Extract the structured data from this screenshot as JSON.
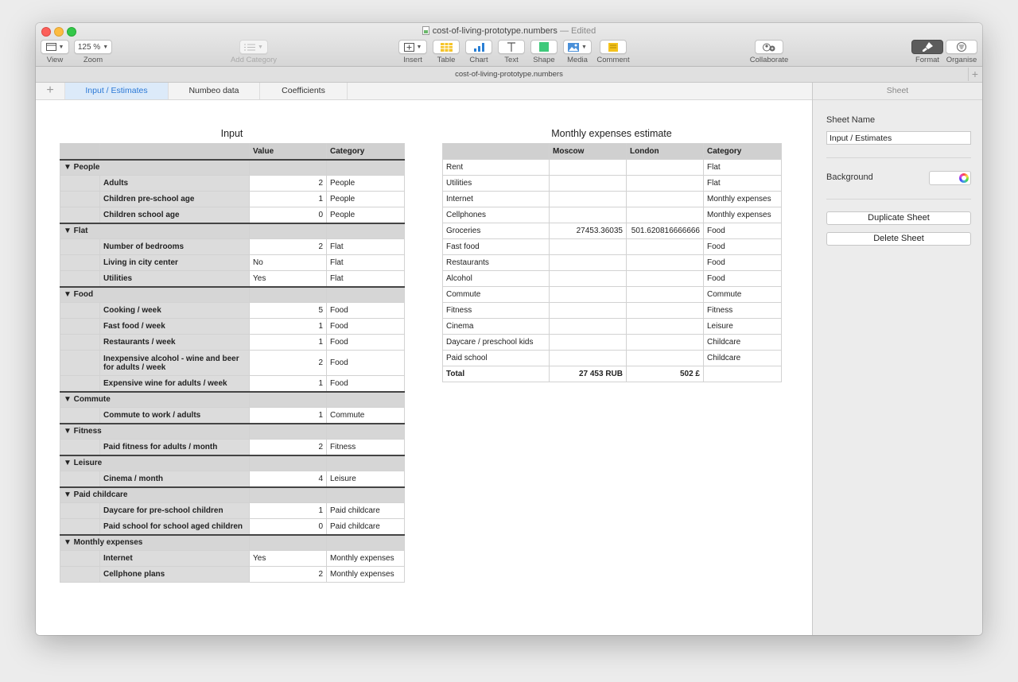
{
  "window": {
    "filename": "cost-of-living-prototype.numbers",
    "edited_suffix": "— Edited",
    "filename_bar": "cost-of-living-prototype.numbers"
  },
  "toolbar": {
    "view_label": "View",
    "zoom_value": "125 %",
    "zoom_label": "Zoom",
    "add_category_label": "Add Category",
    "insert_label": "Insert",
    "table_label": "Table",
    "chart_label": "Chart",
    "text_label": "Text",
    "shape_label": "Shape",
    "media_label": "Media",
    "comment_label": "Comment",
    "collaborate_label": "Collaborate",
    "format_label": "Format",
    "organise_label": "Organise"
  },
  "tabs": [
    {
      "label": "Input / Estimates",
      "active": true
    },
    {
      "label": "Numbeo data",
      "active": false
    },
    {
      "label": "Coefficients",
      "active": false
    }
  ],
  "input_table": {
    "title": "Input",
    "headers": [
      "",
      "",
      "Value",
      "Category"
    ],
    "rows": [
      {
        "type": "group",
        "label": "▼ People"
      },
      {
        "type": "item",
        "label": "Adults",
        "value": "2",
        "num": true,
        "category": "People"
      },
      {
        "type": "item",
        "label": "Children pre-school age",
        "value": "1",
        "num": true,
        "category": "People"
      },
      {
        "type": "item",
        "label": "Children school age",
        "value": "0",
        "num": true,
        "category": "People"
      },
      {
        "type": "group",
        "label": "▼ Flat"
      },
      {
        "type": "item",
        "label": "Number of bedrooms",
        "value": "2",
        "num": true,
        "category": "Flat"
      },
      {
        "type": "item",
        "label": "Living in city center",
        "value": "No",
        "num": false,
        "category": "Flat"
      },
      {
        "type": "item",
        "label": "Utilities",
        "value": "Yes",
        "num": false,
        "category": "Flat"
      },
      {
        "type": "group",
        "label": "▼ Food"
      },
      {
        "type": "item",
        "label": "Cooking / week",
        "value": "5",
        "num": true,
        "category": "Food"
      },
      {
        "type": "item",
        "label": "Fast food / week",
        "value": "1",
        "num": true,
        "category": "Food"
      },
      {
        "type": "item",
        "label": "Restaurants / week",
        "value": "1",
        "num": true,
        "category": "Food"
      },
      {
        "type": "item",
        "label": "Inexpensive alcohol - wine and beer for adults / week",
        "value": "2",
        "num": true,
        "category": "Food",
        "tall": true
      },
      {
        "type": "item",
        "label": "Expensive wine for adults / week",
        "value": "1",
        "num": true,
        "category": "Food"
      },
      {
        "type": "group",
        "label": "▼ Commute"
      },
      {
        "type": "item",
        "label": "Commute to work / adults",
        "value": "1",
        "num": true,
        "category": "Commute"
      },
      {
        "type": "group",
        "label": "▼ Fitness"
      },
      {
        "type": "item",
        "label": "Paid fitness for adults / month",
        "value": "2",
        "num": true,
        "category": "Fitness"
      },
      {
        "type": "group",
        "label": "▼ Leisure"
      },
      {
        "type": "item",
        "label": "Cinema / month",
        "value": "4",
        "num": true,
        "category": "Leisure"
      },
      {
        "type": "group",
        "label": "▼ Paid childcare"
      },
      {
        "type": "item",
        "label": "Daycare for pre-school children",
        "value": "1",
        "num": true,
        "category": "Paid childcare"
      },
      {
        "type": "item",
        "label": "Paid school for school aged children",
        "value": "0",
        "num": true,
        "category": "Paid childcare"
      },
      {
        "type": "group",
        "label": "▼ Monthly expenses"
      },
      {
        "type": "item",
        "label": "Internet",
        "value": "Yes",
        "num": false,
        "category": "Monthly expenses"
      },
      {
        "type": "item",
        "label": "Cellphone plans",
        "value": "2",
        "num": true,
        "category": "Monthly expenses"
      }
    ]
  },
  "expenses_table": {
    "title": "Monthly expenses estimate",
    "headers": [
      "",
      "Moscow",
      "London",
      "Category"
    ],
    "rows": [
      {
        "label": "Rent",
        "moscow": "",
        "london": "",
        "category": "Flat"
      },
      {
        "label": "Utilities",
        "moscow": "",
        "london": "",
        "category": "Flat"
      },
      {
        "label": "Internet",
        "moscow": "",
        "london": "",
        "category": "Monthly expenses"
      },
      {
        "label": "Cellphones",
        "moscow": "",
        "london": "",
        "category": "Monthly expenses"
      },
      {
        "label": "Groceries",
        "moscow": "27453.36035",
        "london": "501.620816666666",
        "category": "Food"
      },
      {
        "label": "Fast food",
        "moscow": "",
        "london": "",
        "category": "Food"
      },
      {
        "label": "Restaurants",
        "moscow": "",
        "london": "",
        "category": "Food"
      },
      {
        "label": "Alcohol",
        "moscow": "",
        "london": "",
        "category": "Food"
      },
      {
        "label": "Commute",
        "moscow": "",
        "london": "",
        "category": "Commute"
      },
      {
        "label": "Fitness",
        "moscow": "",
        "london": "",
        "category": "Fitness"
      },
      {
        "label": "Cinema",
        "moscow": "",
        "london": "",
        "category": "Leisure"
      },
      {
        "label": "Daycare / preschool kids",
        "moscow": "",
        "london": "",
        "category": "Childcare"
      },
      {
        "label": "Paid school",
        "moscow": "",
        "london": "",
        "category": "Childcare"
      }
    ],
    "total": {
      "label": "Total",
      "moscow": "27 453 RUB",
      "london": "502 £",
      "category": ""
    }
  },
  "sidebar": {
    "header": "Sheet",
    "sheet_name_label": "Sheet Name",
    "sheet_name_value": "Input / Estimates",
    "background_label": "Background",
    "duplicate_label": "Duplicate Sheet",
    "delete_label": "Delete Sheet"
  }
}
